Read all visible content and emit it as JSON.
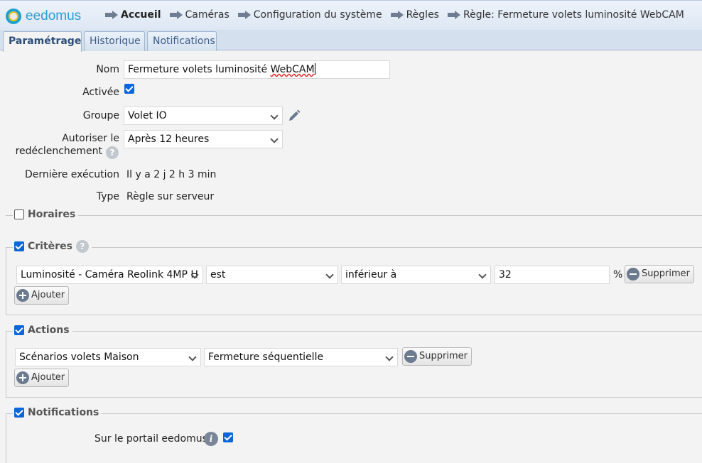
{
  "app": {
    "logo_text": "eedomus"
  },
  "breadcrumb": [
    {
      "label": "Accueil"
    },
    {
      "label": "Caméras"
    },
    {
      "label": "Configuration du système"
    },
    {
      "label": "Règles"
    },
    {
      "label": "Règle: Fermeture volets luminosité WebCAM"
    }
  ],
  "tabs": [
    {
      "label": "Paramétrage"
    },
    {
      "label": "Historique"
    },
    {
      "label": "Notifications"
    }
  ],
  "form": {
    "nom_label": "Nom",
    "nom_value_main": "Fermeture volets luminosité ",
    "nom_value_misspelled": "WebCAM",
    "activee_label": "Activée",
    "activee_checked": true,
    "groupe_label": "Groupe",
    "groupe_value": "Volet IO",
    "redecl_label_1": "Autoriser le",
    "redecl_label_2": "redéclenchement",
    "redecl_value": "Après 12 heures",
    "derniere_label": "Dernière exécution",
    "derniere_value": "Il y a 2 j 2 h 3 min",
    "type_label": "Type",
    "type_value": "Règle sur serveur"
  },
  "horaires": {
    "legend": "Horaires",
    "checked": false
  },
  "criteres": {
    "legend": "Critères",
    "checked": true,
    "row": {
      "device": "Luminosité - Caméra Reolink 4MP H",
      "operator_verb": "est",
      "comparator": "inférieur à",
      "value": "32",
      "unit": "%",
      "remove_label": "Supprimer"
    },
    "add_label": "Ajouter"
  },
  "actions": {
    "legend": "Actions",
    "checked": true,
    "row": {
      "device": "Scénarios volets Maison",
      "action": "Fermeture séquentielle",
      "remove_label": "Supprimer"
    },
    "add_label": "Ajouter"
  },
  "notifications": {
    "legend": "Notifications",
    "checked": true,
    "portal_label": "Sur le portail eedomus",
    "portal_checked": true
  },
  "colors": {
    "accent": "#0a66d9",
    "tab_text": "#3a5c86",
    "logo": "#2a9fd6"
  }
}
